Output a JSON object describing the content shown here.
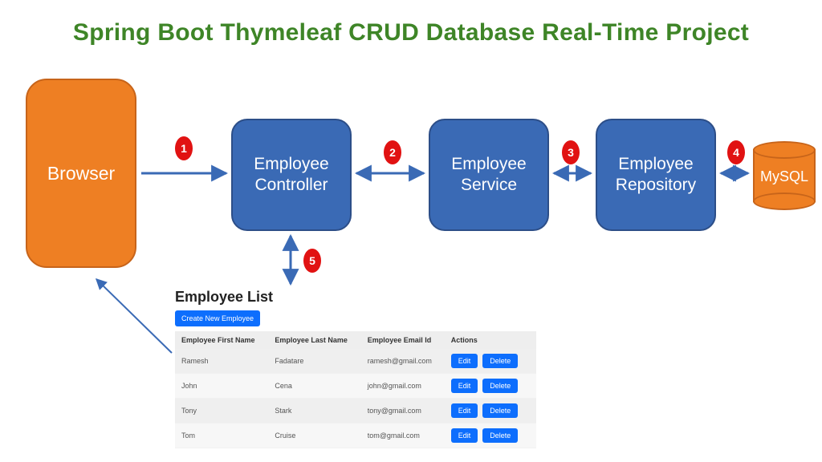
{
  "title": "Spring Boot Thymeleaf CRUD Database Real-Time Project",
  "blocks": {
    "browser": "Browser",
    "controller_l1": "Employee",
    "controller_l2": "Controller",
    "service_l1": "Employee",
    "service_l2": "Service",
    "repo_l1": "Employee",
    "repo_l2": "Repository",
    "db": "MySQL"
  },
  "steps": {
    "s1": "1",
    "s2": "2",
    "s3": "3",
    "s4": "4",
    "s5": "5"
  },
  "list": {
    "heading": "Employee List",
    "create_label": "Create New Employee",
    "columns": {
      "first": "Employee First Name",
      "last": "Employee Last Name",
      "email": "Employee Email Id",
      "actions": "Actions"
    },
    "action_labels": {
      "edit": "Edit",
      "delete": "Delete"
    },
    "rows": [
      {
        "first": "Ramesh",
        "last": "Fadatare",
        "email": "ramesh@gmail.com"
      },
      {
        "first": "John",
        "last": "Cena",
        "email": "john@gmail.com"
      },
      {
        "first": "Tony",
        "last": "Stark",
        "email": "tony@gmail.com"
      },
      {
        "first": "Tom",
        "last": "Cruise",
        "email": "tom@gmail.com"
      }
    ]
  },
  "colors": {
    "title": "#3e8527",
    "orange": "#ee7f23",
    "blue_box": "#3a6ab5",
    "arrow": "#3a6ab5",
    "badge": "#e11212",
    "primary_btn": "#0d6efd"
  }
}
